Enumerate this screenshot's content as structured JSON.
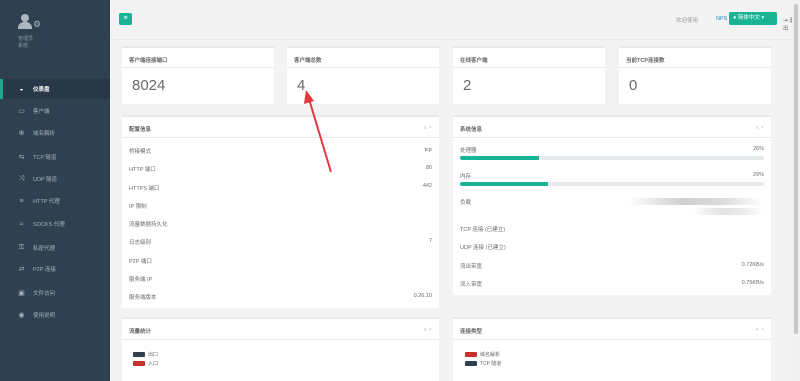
{
  "sidebar": {
    "profile_name": "管理员",
    "profile_role": "系统",
    "items": [
      {
        "icon": "dashboard-icon",
        "glyph": "◒",
        "label": "仪表盘",
        "active": true
      },
      {
        "icon": "monitor-icon",
        "glyph": "▭",
        "label": "客户端",
        "active": false
      },
      {
        "icon": "globe-icon",
        "glyph": "⊕",
        "label": "域名解析",
        "active": false
      },
      {
        "icon": "tunnel-icon",
        "glyph": "⇆",
        "label": "TCP 隧道",
        "active": false
      },
      {
        "icon": "shuffle-icon",
        "glyph": "⤨",
        "label": "UDP 隧道",
        "active": false
      },
      {
        "icon": "server-icon",
        "glyph": "≡",
        "label": "HTTP 代理",
        "active": false
      },
      {
        "icon": "layers-icon",
        "glyph": "≈",
        "label": "SOCKS 代理",
        "active": false
      },
      {
        "icon": "key-icon",
        "glyph": "⚿",
        "label": "私密代理",
        "active": false
      },
      {
        "icon": "exchange-icon",
        "glyph": "⇄",
        "label": "P2P 连接",
        "active": false
      },
      {
        "icon": "folder-icon",
        "glyph": "▣",
        "label": "文件访问",
        "active": false
      },
      {
        "icon": "bulb-icon",
        "glyph": "◉",
        "label": "使用说明",
        "active": false
      }
    ]
  },
  "topbar": {
    "menu_glyph": "≡",
    "welcome": "欢迎使用",
    "nps": "NPS",
    "lang": "● 简体中文 ▾",
    "logout": "⇥ 退出"
  },
  "stats": [
    {
      "title": "客户端连接端口",
      "value": "8024"
    },
    {
      "title": "客户端总数",
      "value": "4"
    },
    {
      "title": "在线客户端",
      "value": "2"
    },
    {
      "title": "当前TCP连接数",
      "value": "0"
    }
  ],
  "config": {
    "title": "配置信息",
    "tools": "∧ ×",
    "rows": [
      {
        "label": "桥接模式",
        "value": "tcp"
      },
      {
        "label": "HTTP 端口",
        "value": "80"
      },
      {
        "label": "HTTPS 端口",
        "value": "442"
      },
      {
        "label": "IP 限制",
        "value": ""
      },
      {
        "label": "流量数据持久化",
        "value": ""
      },
      {
        "label": "日志级别",
        "value": "7"
      },
      {
        "label": "P2P 端口",
        "value": ""
      },
      {
        "label": "服务端 IP",
        "value": ""
      },
      {
        "label": "服务端版本",
        "value": "0.26.10"
      }
    ]
  },
  "system": {
    "title": "系统信息",
    "tools": "∧ ×",
    "cpu_label": "处理器",
    "cpu_value": "26%",
    "cpu_fraction": 0.26,
    "mem_label": "内存",
    "mem_value": "29%",
    "mem_fraction": 0.29,
    "load_label": "负载",
    "tcp_label": "TCP 连接 (已建立)",
    "udp_label": "UDP 连接 (已建立)",
    "out_label": "流出带宽",
    "out_value": "0.72KB/s",
    "in_label": "流入带宽",
    "in_value": "0.75KB/s"
  },
  "traffic": {
    "title": "流量统计",
    "tools": "∧ ×",
    "legend": [
      {
        "label": "出口",
        "color": "#2f4050"
      },
      {
        "label": "入口",
        "color": "#c9302c"
      }
    ]
  },
  "conn_types": {
    "title": "连接类型",
    "tools": "∧ ×",
    "legend": [
      {
        "label": "域名解析",
        "color": "#c9302c"
      },
      {
        "label": "TCP 隧道",
        "color": "#2f4050"
      }
    ]
  },
  "colors": {
    "sidebar": "#2f4050",
    "accent": "#1ab394",
    "annotation_arrow": "#e0393e"
  }
}
